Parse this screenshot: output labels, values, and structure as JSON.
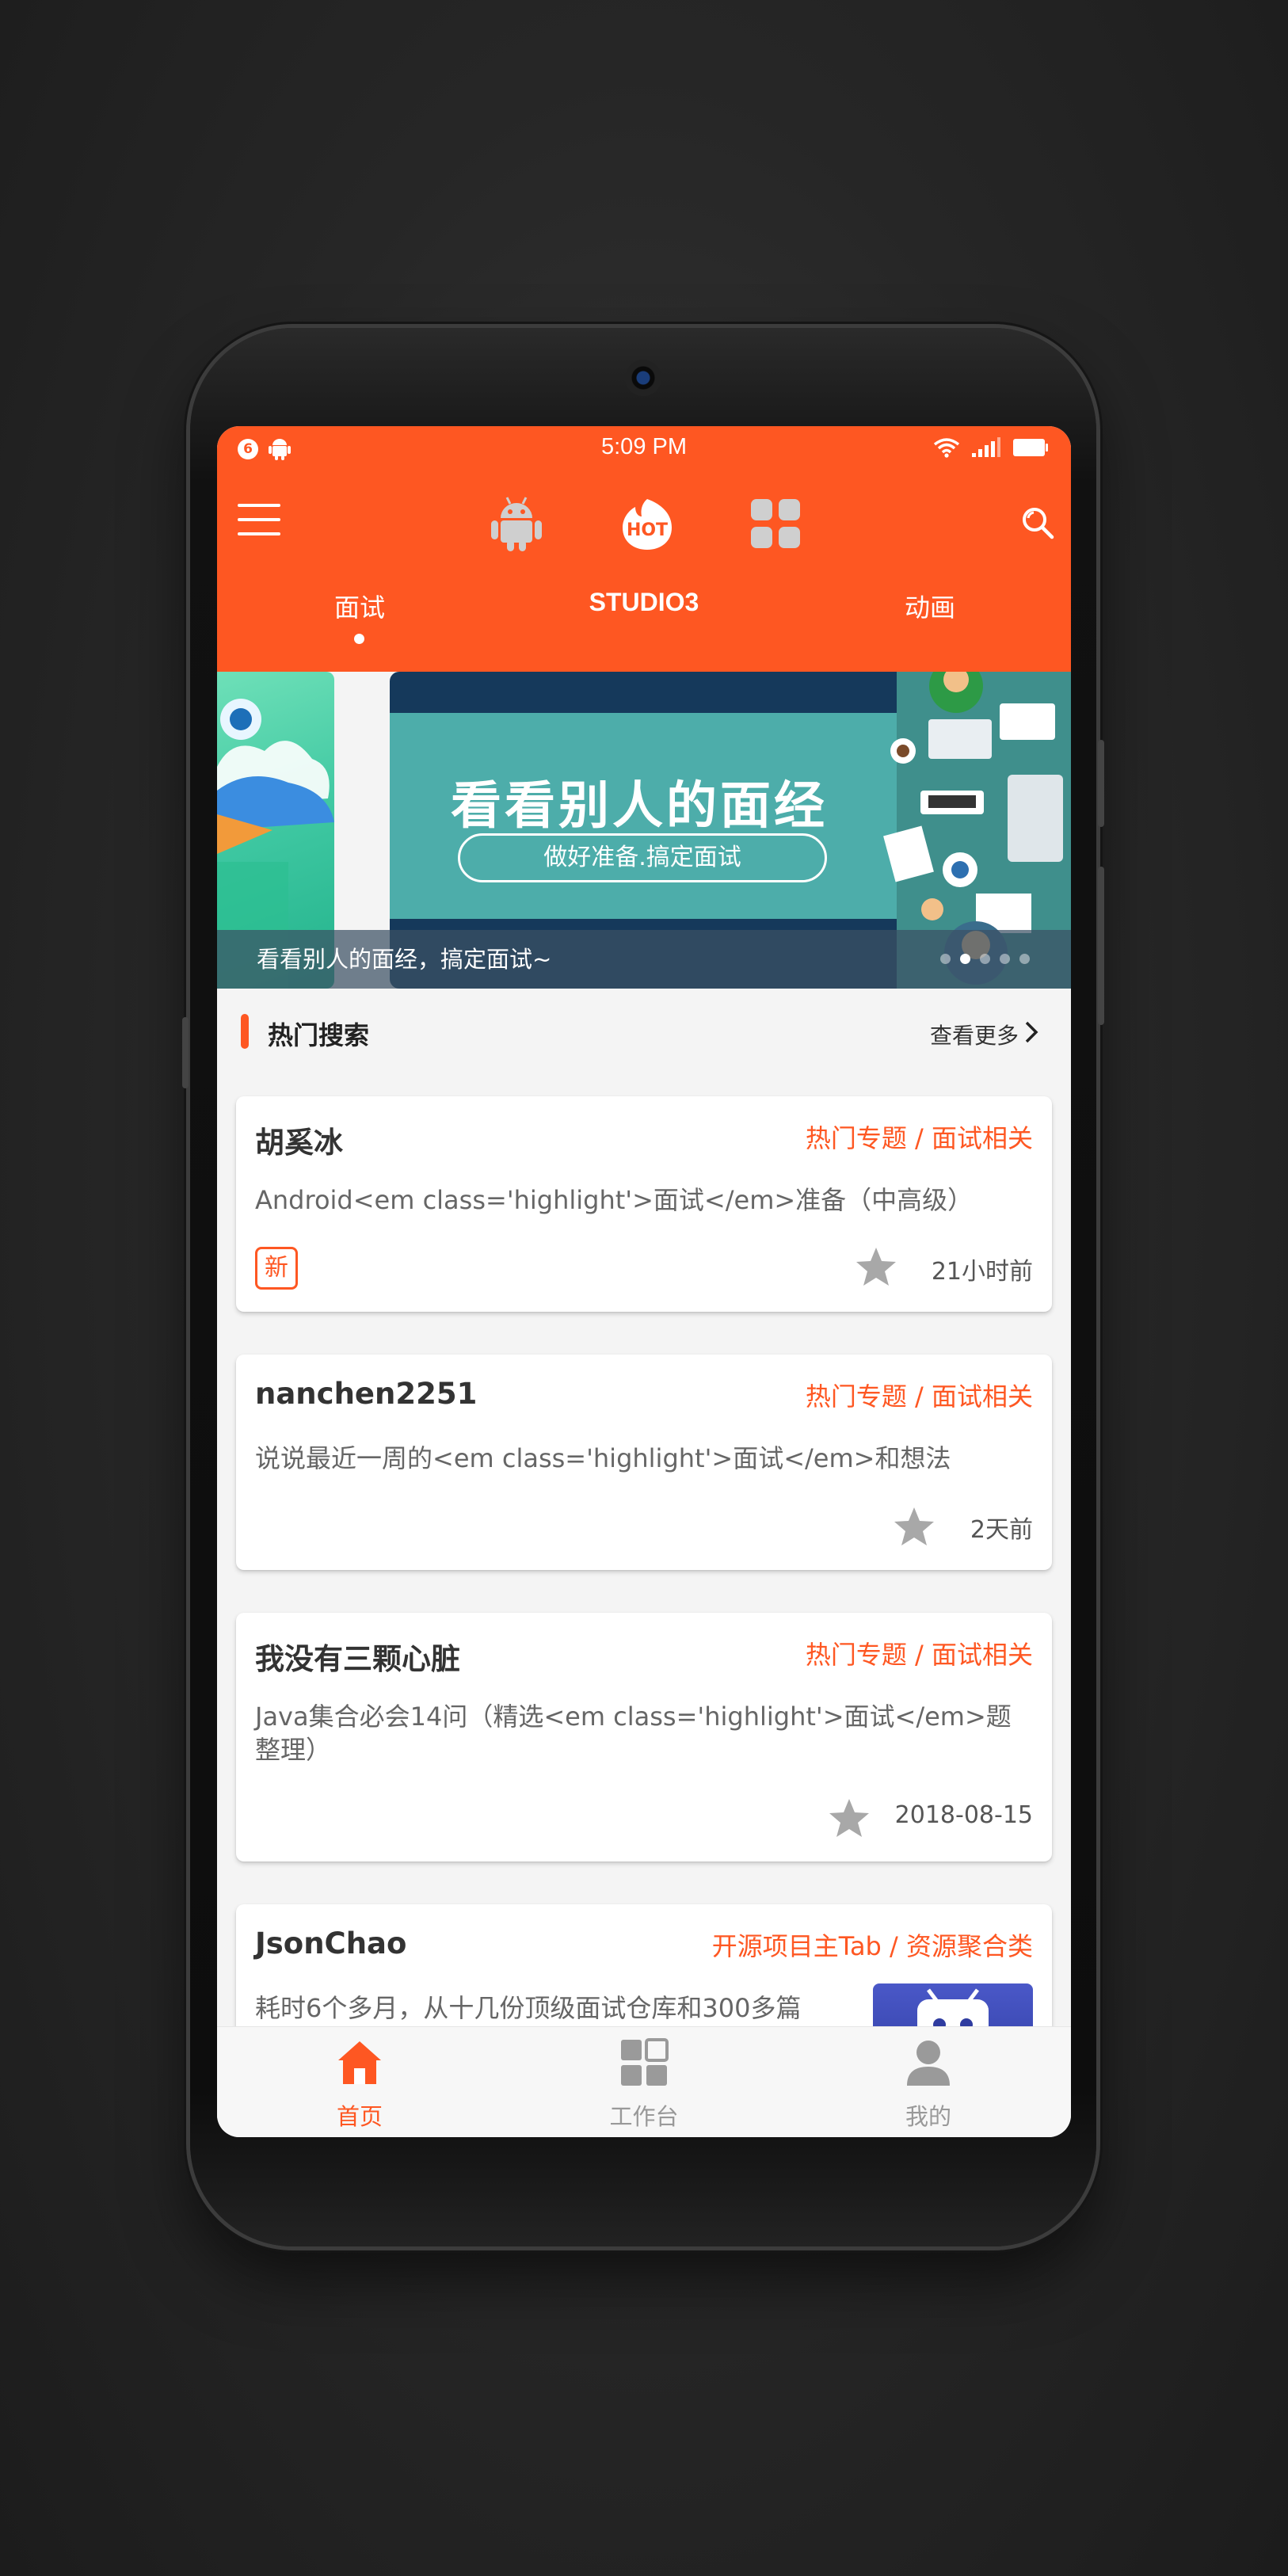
{
  "status_bar": {
    "badge": "6",
    "time": "5:09 PM"
  },
  "toolbar": {
    "hot_label": "HOT"
  },
  "tabs": [
    {
      "label": "面试",
      "active": true
    },
    {
      "label": "STUDIO3",
      "active": false
    },
    {
      "label": "动画",
      "active": false
    }
  ],
  "banner": {
    "title": "看看别人的面经",
    "pill": "做好准备.搞定面试",
    "caption": "看看别人的面经，搞定面试~",
    "page_count": 5,
    "active_index": 1
  },
  "section": {
    "title": "热门搜索",
    "more": "查看更多"
  },
  "cards": [
    {
      "author": "胡奚冰",
      "category": "热门专题 / 面试相关",
      "title": "Android<em class='highlight'>面试</em>准备（中高级）",
      "is_new": true,
      "new_label": "新",
      "time": "21小时前"
    },
    {
      "author": "nanchen2251",
      "category": "热门专题 / 面试相关",
      "title": "说说最近一周的<em class='highlight'>面试</em>和想法",
      "is_new": false,
      "time": "2天前"
    },
    {
      "author": "我没有三颗心脏",
      "category": "热门专题 / 面试相关",
      "title": "Java集合必会14问（精选<em class='highlight'>面试</em>题整理）",
      "is_new": false,
      "time": "2018-08-15"
    },
    {
      "author": "JsonChao",
      "category": "开源项目主Tab / 资源聚合类",
      "title": "耗时6个多月，从十几份顶级面试仓库和300多篇",
      "is_new": false,
      "time": ""
    }
  ],
  "bottom_nav": [
    {
      "label": "首页",
      "icon": "home-icon",
      "active": true
    },
    {
      "label": "工作台",
      "icon": "dashboard-icon",
      "active": false
    },
    {
      "label": "我的",
      "icon": "person-icon",
      "active": false
    }
  ],
  "colors": {
    "accent": "#fe5722",
    "background": "#f4f4f4",
    "inactive": "#999999"
  }
}
